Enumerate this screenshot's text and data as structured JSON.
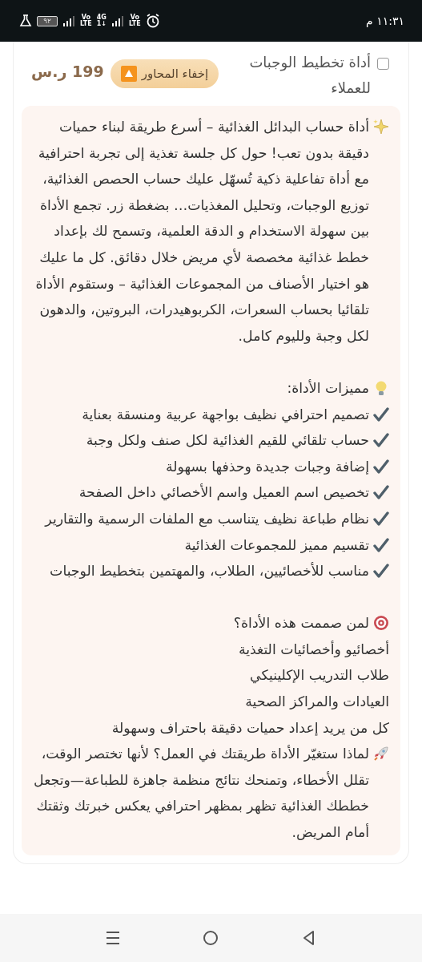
{
  "status_bar": {
    "time": "١١:٣١ م",
    "battery": "٩٢",
    "network": [
      {
        "kind": "volte",
        "top": "Vo",
        "bottom": "LTE"
      },
      {
        "kind": "data",
        "top": "4G",
        "bottom": "1↓"
      },
      {
        "kind": "volte",
        "top": "Vo",
        "bottom": "LTE"
      }
    ]
  },
  "product": {
    "checked": false,
    "name": "أداة تخطيط الوجبات للعملاء",
    "toggle_label": "إخفاء المحاور",
    "price": "199 ر.س"
  },
  "description": {
    "intro": "أداة حساب البدائل الغذائية – أسرع طريقة لبناء حميات دقيقة بدون تعب! حول كل جلسة تغذية إلى تجربة احترافية مع أداة تفاعلية ذكية تُسهّل عليك حساب الحصص الغذائية، توزيع الوجبات، وتحليل المغذيات… بضغطة زر. تجمع الأداة بين سهولة الاستخدام و الدقة العلمية، وتسمح لك بإعداد خطط غذائية مخصصة لأي مريض خلال دقائق. كل ما عليك هو اختيار الأصناف من المجموعات الغذائية – وستقوم الأداة تلقائيا بحساب السعرات، الكربوهيدرات، البروتين، والدهون لكل وجبة ولليوم كامل.",
    "features_title": "مميزات الأداة:",
    "features": [
      "تصميم احترافي نظيف بواجهة عربية ومنسقة بعناية",
      "حساب تلقائي للقيم الغذائية لكل صنف ولكل وجبة",
      "إضافة وجبات جديدة وحذفها بسهولة",
      "تخصيص اسم العميل واسم الأخصائي داخل الصفحة",
      "نظام طباعة نظيف يتناسب مع الملفات الرسمية والتقارير",
      "تقسيم مميز للمجموعات الغذائية",
      "مناسب للأخصائيين، الطلاب، والمهتمين بتخطيط الوجبات"
    ],
    "audience_title": "لمن صممت هذه الأداة؟",
    "audience": [
      "أخصائيو وأخصائيات التغذية",
      "طلاب التدريب الإكلينيكي",
      "العيادات والمراكز الصحية",
      "كل من يريد إعداد حميات دقيقة باحتراف وسهولة"
    ],
    "closing": "لماذا ستغيّر الأداة طريقتك في العمل؟ لأنها تختصر الوقت، تقلل الأخطاء، وتمنحك نتائج منظمة جاهزة للطباعة—وتجعل خططك الغذائية تظهر بمظهر احترافي يعكس خبرتك وثقتك أمام المريض."
  }
}
